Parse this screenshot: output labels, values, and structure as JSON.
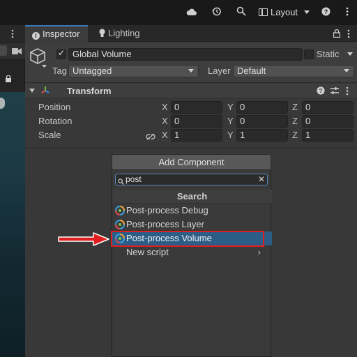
{
  "toolbar": {
    "icons": [
      "cloud-icon",
      "history-icon",
      "search-icon",
      "help-icon",
      "more-icon"
    ],
    "layout_label": "Layout"
  },
  "tabs": [
    {
      "label": "Inspector",
      "icon": "info-icon"
    },
    {
      "label": "Lighting",
      "icon": "bulb-icon"
    }
  ],
  "header": {
    "object_name": "Global Volume",
    "active": true,
    "static_label": "Static",
    "static_checked": false,
    "tag_label": "Tag",
    "tag_value": "Untagged",
    "layer_label": "Layer",
    "layer_value": "Default"
  },
  "transform": {
    "title": "Transform",
    "rows": [
      {
        "label": "Position",
        "x": "0",
        "y": "0",
        "z": "0"
      },
      {
        "label": "Rotation",
        "x": "0",
        "y": "0",
        "z": "0"
      },
      {
        "label": "Scale",
        "x": "1",
        "y": "1",
        "z": "1"
      }
    ],
    "axis_x": "X",
    "axis_y": "Y",
    "axis_z": "Z"
  },
  "add_component": {
    "button_label": "Add Component",
    "search_value": "post",
    "popup_title": "Search",
    "results": [
      {
        "label": "Post-process Debug",
        "selected": false
      },
      {
        "label": "Post-process Layer",
        "selected": false
      },
      {
        "label": "Post-process Volume",
        "selected": true
      }
    ],
    "new_script_label": "New script"
  },
  "colors": {
    "accent": "#3a79bb",
    "selection": "#2c5d87",
    "highlight_annotation": "#e01e1e"
  }
}
